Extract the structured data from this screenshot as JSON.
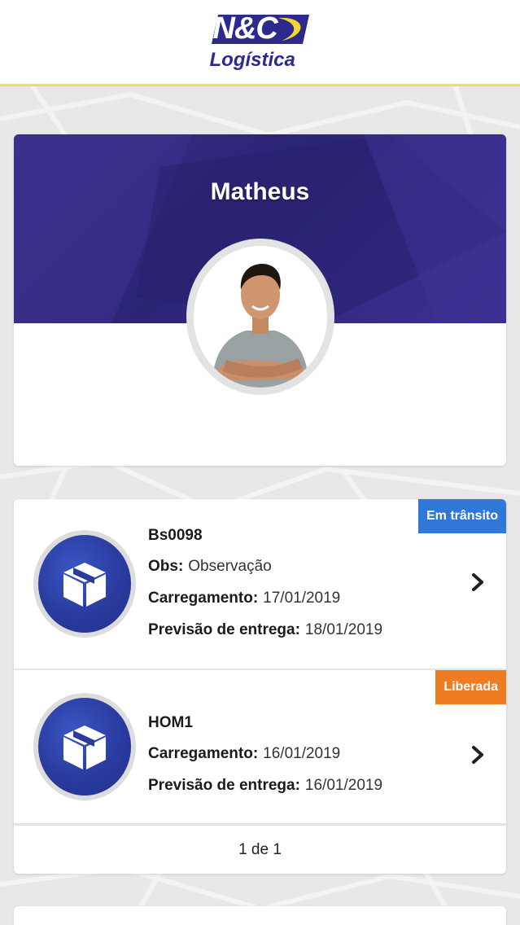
{
  "header": {
    "logo_brand": "N&C",
    "logo_sub": "Logística"
  },
  "profile": {
    "name": "Matheus"
  },
  "shipments": [
    {
      "code": "Bs0098",
      "status": "Em trânsito",
      "status_color": "#2f78d8",
      "obs_label": "Obs:",
      "obs_value": "Observação",
      "loading_label": "Carregamento:",
      "loading_value": "17/01/2019",
      "forecast_label": "Previsão de entrega:",
      "forecast_value": "18/01/2019",
      "icon": "package-icon"
    },
    {
      "code": "HOM1",
      "status": "Liberada",
      "status_color": "#f07c22",
      "loading_label": "Carregamento:",
      "loading_value": "16/01/2019",
      "forecast_label": "Previsão de entrega:",
      "forecast_value": "16/01/2019",
      "icon": "package-icon"
    }
  ],
  "pagination": {
    "label": "1 de 1"
  },
  "colors": {
    "brand": "#2d2a8e",
    "banner": "#2b2576",
    "header_accent": "#f2e04a"
  }
}
